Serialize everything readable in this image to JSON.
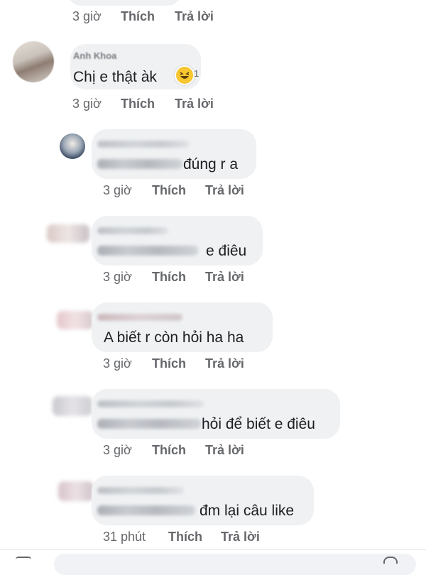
{
  "top_row": {
    "time": "3 giờ",
    "like": "Thích",
    "reply": "Trả lời"
  },
  "comments": [
    {
      "author": "Anh Khoa",
      "text": "Chị e thật àk",
      "time": "3 giờ",
      "like": "Thích",
      "reply": "Trả lời",
      "reaction_icon": "laughing-emoji",
      "reaction_count": "1"
    },
    {
      "text": "đúng r a",
      "time": "3 giờ",
      "like": "Thích",
      "reply": "Trả lời"
    },
    {
      "text": "e điêu",
      "time": "3 giờ",
      "like": "Thích",
      "reply": "Trả lời"
    },
    {
      "text": "A biết r còn hỏi ha ha",
      "time": "3 giờ",
      "like": "Thích",
      "reply": "Trả lời"
    },
    {
      "text": "hỏi để biết e điêu",
      "time": "3 giờ",
      "like": "Thích",
      "reply": "Trả lời"
    },
    {
      "text": "đm lại câu like",
      "time": "31 phút",
      "like": "Thích",
      "reply": "Trả lời"
    }
  ],
  "colors": {
    "bubble": "#eff1f3",
    "meta": "#65676b",
    "text": "#1c1e21"
  }
}
